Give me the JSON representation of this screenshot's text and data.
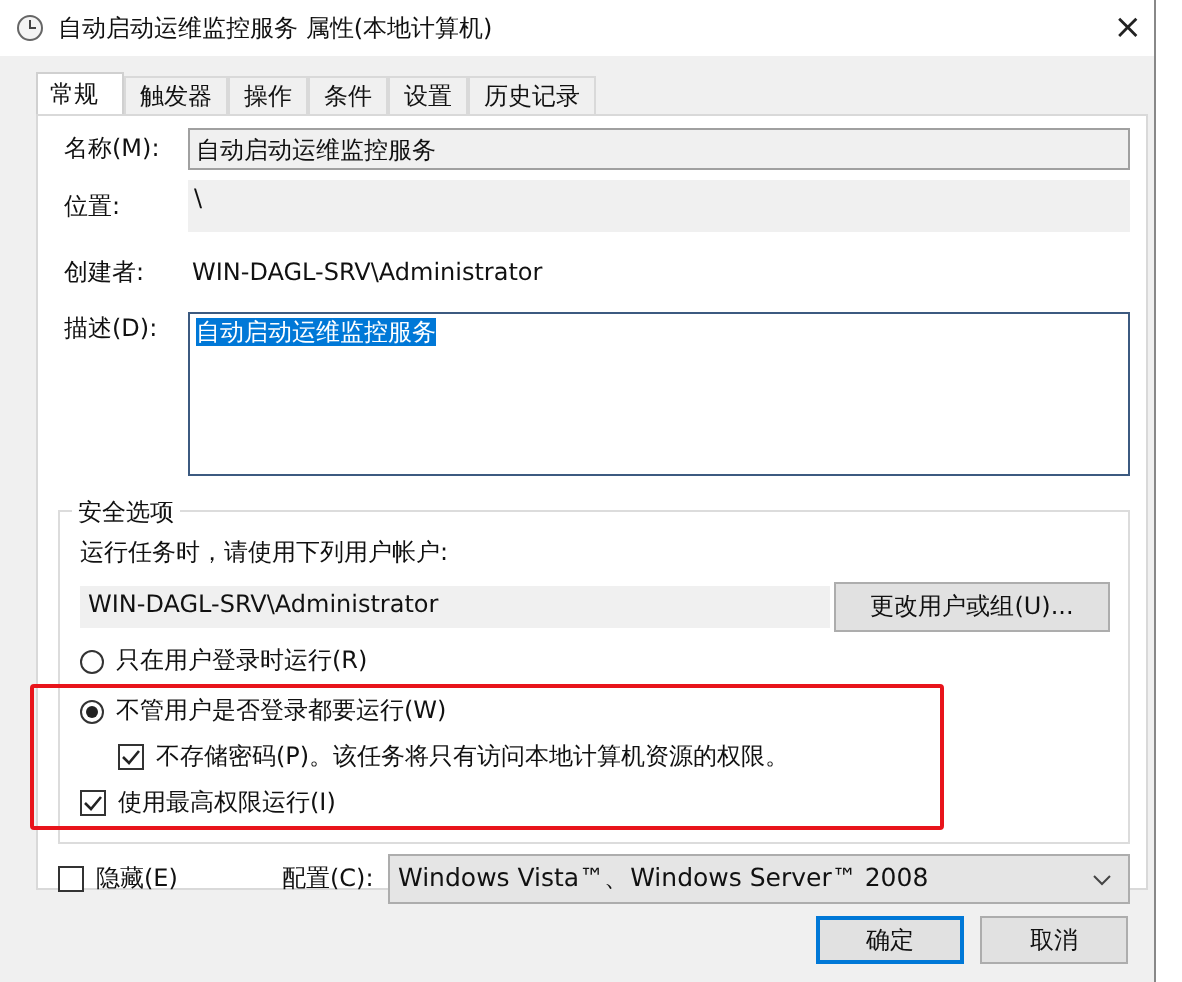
{
  "window": {
    "title": "自动启动运维监控服务 属性(本地计算机)",
    "close": "×"
  },
  "tabs": [
    {
      "label": "常规",
      "selected": true
    },
    {
      "label": "触发器",
      "selected": false
    },
    {
      "label": "操作",
      "selected": false
    },
    {
      "label": "条件",
      "selected": false
    },
    {
      "label": "设置",
      "selected": false
    },
    {
      "label": "历史记录",
      "selected": false
    }
  ],
  "general": {
    "name_label": "名称(M):",
    "name_value": "自动启动运维监控服务",
    "location_label": "位置:",
    "location_value": "\\",
    "author_label": "创建者:",
    "author_value": "WIN-DAGL-SRV\\Administrator",
    "description_label": "描述(D):",
    "description_value": "自动启动运维监控服务",
    "description_selected": true
  },
  "security": {
    "title": "安全选项",
    "account_prompt": "运行任务时，请使用下列用户帐户:",
    "account_value": "WIN-DAGL-SRV\\Administrator",
    "change_button": "更改用户或组(U)...",
    "options": [
      {
        "kind": "radio",
        "label": "只在用户登录时运行(R)",
        "selected": false,
        "highlighted": false
      },
      {
        "kind": "radio",
        "label": "不管用户是否登录都要运行(W)",
        "selected": true,
        "highlighted": true
      },
      {
        "kind": "subcheckbox",
        "label": "不存储密码(P)。该任务将只有访问本地计算机资源的权限。",
        "checked": true,
        "highlighted": true
      },
      {
        "kind": "checkbox",
        "label": "使用最高权限运行(I)",
        "checked": true,
        "highlighted": true
      }
    ]
  },
  "hidden": {
    "label": "隐藏(E)",
    "checked": false
  },
  "configure": {
    "label": "配置(C):",
    "value": "Windows Vista™、Windows Server™ 2008"
  },
  "buttons": [
    {
      "label": "确定",
      "default": true
    },
    {
      "label": "取消",
      "default": false
    }
  ]
}
